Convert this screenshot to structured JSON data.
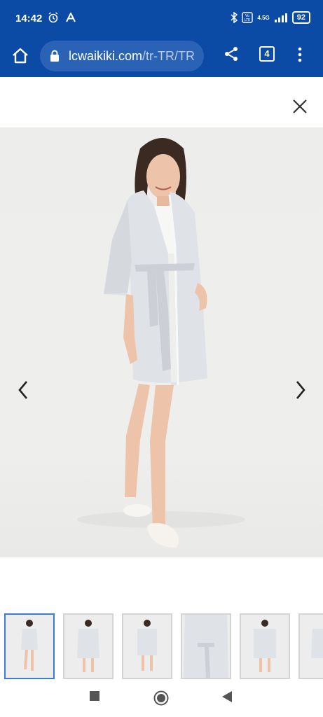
{
  "status_bar": {
    "time": "14:42",
    "left_icons": [
      "alarm-icon",
      "a-icon"
    ],
    "right_icons": [
      "bluetooth-icon",
      "volte-icon",
      "signal-icon"
    ],
    "network": "4.5G",
    "battery": "92"
  },
  "browser": {
    "url_domain": "lcwaikiki.com",
    "url_path": "/tr-TR/TR",
    "tab_count": "4"
  },
  "gallery": {
    "thumbnail_count": 6,
    "active_index": 0,
    "product_color": "#dfe2e6"
  },
  "colors": {
    "browser_blue": "#0b4aa5",
    "active_border": "#3a7bd5"
  }
}
